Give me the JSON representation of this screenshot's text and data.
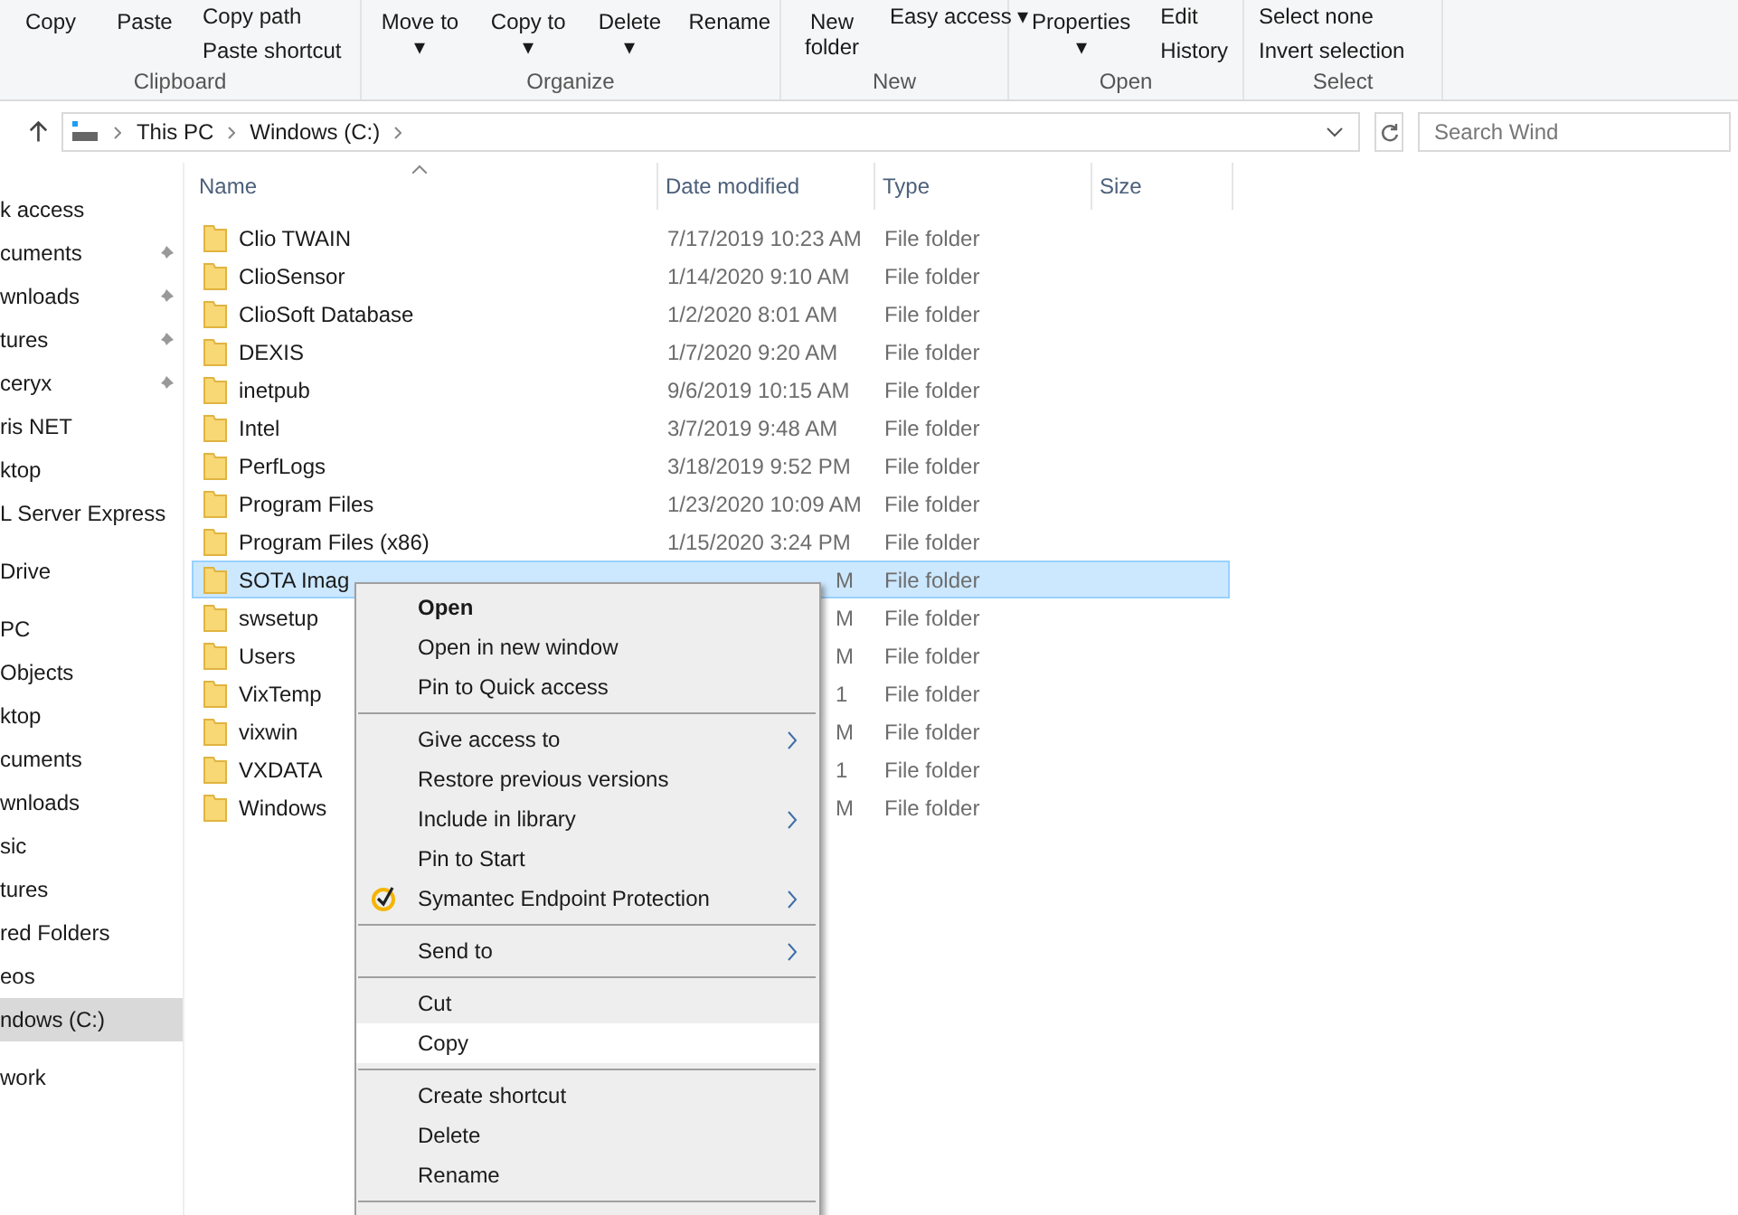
{
  "ribbon": {
    "groups": [
      {
        "label": "Clipboard",
        "large": [
          "Copy",
          "Paste"
        ],
        "small": [
          "Copy path",
          "Paste shortcut"
        ]
      },
      {
        "label": "Organize",
        "large": [
          "Move to ▾",
          "Copy to ▾",
          "Delete ▾",
          "Rename"
        ]
      },
      {
        "label": "New",
        "large": [
          "New folder"
        ],
        "small": [
          "Easy access ▾"
        ]
      },
      {
        "label": "Open",
        "large": [
          "Properties ▾"
        ],
        "small": [
          "Edit",
          "History"
        ]
      },
      {
        "label": "Select",
        "small": [
          "Select none",
          "Invert selection"
        ]
      }
    ]
  },
  "address_bar": {
    "crumbs": [
      "This PC",
      "Windows (C:)"
    ],
    "search_placeholder": "Search Wind"
  },
  "sidebar": {
    "sections": [
      {
        "items": [
          {
            "label": "k access",
            "pinned": false,
            "selected": false
          },
          {
            "label": "cuments",
            "pinned": true,
            "selected": false
          },
          {
            "label": "wnloads",
            "pinned": true,
            "selected": false
          },
          {
            "label": "tures",
            "pinned": true,
            "selected": false
          },
          {
            "label": "ceryx",
            "pinned": true,
            "selected": false
          },
          {
            "label": "ris NET",
            "pinned": false,
            "selected": false
          },
          {
            "label": "ktop",
            "pinned": false,
            "selected": false
          },
          {
            "label": "L Server Express",
            "pinned": false,
            "selected": false
          }
        ]
      },
      {
        "items": [
          {
            "label": "Drive",
            "pinned": false,
            "selected": false
          }
        ]
      },
      {
        "items": [
          {
            "label": "PC",
            "pinned": false,
            "selected": false
          },
          {
            "label": "Objects",
            "pinned": false,
            "selected": false
          },
          {
            "label": "ktop",
            "pinned": false,
            "selected": false
          },
          {
            "label": "cuments",
            "pinned": false,
            "selected": false
          },
          {
            "label": "wnloads",
            "pinned": false,
            "selected": false
          },
          {
            "label": "sic",
            "pinned": false,
            "selected": false
          },
          {
            "label": "tures",
            "pinned": false,
            "selected": false
          },
          {
            "label": "red Folders",
            "pinned": false,
            "selected": false
          },
          {
            "label": "eos",
            "pinned": false,
            "selected": false
          },
          {
            "label": "ndows (C:)",
            "pinned": false,
            "selected": true
          }
        ]
      },
      {
        "items": [
          {
            "label": "work",
            "pinned": false,
            "selected": false
          }
        ]
      }
    ]
  },
  "table": {
    "columns": [
      "Name",
      "Date modified",
      "Type",
      "Size"
    ],
    "rows": [
      {
        "name": "Clio TWAIN",
        "date": "7/17/2019 10:23 AM",
        "date_covered": false,
        "type": "File folder",
        "selected": false
      },
      {
        "name": "ClioSensor",
        "date": "1/14/2020 9:10 AM",
        "date_covered": false,
        "type": "File folder",
        "selected": false
      },
      {
        "name": "ClioSoft Database",
        "date": "1/2/2020 8:01 AM",
        "date_covered": false,
        "type": "File folder",
        "selected": false
      },
      {
        "name": "DEXIS",
        "date": "1/7/2020 9:20 AM",
        "date_covered": false,
        "type": "File folder",
        "selected": false
      },
      {
        "name": "inetpub",
        "date": "9/6/2019 10:15 AM",
        "date_covered": false,
        "type": "File folder",
        "selected": false
      },
      {
        "name": "Intel",
        "date": "3/7/2019 9:48 AM",
        "date_covered": false,
        "type": "File folder",
        "selected": false
      },
      {
        "name": "PerfLogs",
        "date": "3/18/2019 9:52 PM",
        "date_covered": false,
        "type": "File folder",
        "selected": false
      },
      {
        "name": "Program Files",
        "date": "1/23/2020 10:09 AM",
        "date_covered": false,
        "type": "File folder",
        "selected": false
      },
      {
        "name": "Program Files (x86)",
        "date": "1/15/2020 3:24 PM",
        "date_covered": false,
        "type": "File folder",
        "selected": false
      },
      {
        "name": "SOTA Imag",
        "date": "M",
        "date_covered": true,
        "type": "File folder",
        "selected": true
      },
      {
        "name": "swsetup",
        "date": "M",
        "date_covered": true,
        "type": "File folder",
        "selected": false
      },
      {
        "name": "Users",
        "date": "M",
        "date_covered": true,
        "type": "File folder",
        "selected": false
      },
      {
        "name": "VixTemp",
        "date": "1",
        "date_covered": true,
        "type": "File folder",
        "selected": false
      },
      {
        "name": "vixwin",
        "date": "M",
        "date_covered": true,
        "type": "File folder",
        "selected": false
      },
      {
        "name": "VXDATA",
        "date": "1",
        "date_covered": true,
        "type": "File folder",
        "selected": false
      },
      {
        "name": "Windows",
        "date": "M",
        "date_covered": true,
        "type": "File folder",
        "selected": false
      }
    ]
  },
  "context_menu": {
    "items": [
      {
        "kind": "item",
        "label": "Open",
        "bold": true,
        "submenu": false,
        "hovered": false
      },
      {
        "kind": "item",
        "label": "Open in new window",
        "bold": false,
        "submenu": false,
        "hovered": false
      },
      {
        "kind": "item",
        "label": "Pin to Quick access",
        "bold": false,
        "submenu": false,
        "hovered": false
      },
      {
        "kind": "separator"
      },
      {
        "kind": "item",
        "label": "Give access to",
        "bold": false,
        "submenu": true,
        "hovered": false
      },
      {
        "kind": "item",
        "label": "Restore previous versions",
        "bold": false,
        "submenu": false,
        "hovered": false
      },
      {
        "kind": "item",
        "label": "Include in library",
        "bold": false,
        "submenu": true,
        "hovered": false
      },
      {
        "kind": "item",
        "label": "Pin to Start",
        "bold": false,
        "submenu": false,
        "hovered": false
      },
      {
        "kind": "icon_item",
        "label": "Symantec Endpoint Protection",
        "bold": false,
        "submenu": true,
        "hovered": false
      },
      {
        "kind": "separator"
      },
      {
        "kind": "item",
        "label": "Send to",
        "bold": false,
        "submenu": true,
        "hovered": false
      },
      {
        "kind": "separator"
      },
      {
        "kind": "item",
        "label": "Cut",
        "bold": false,
        "submenu": false,
        "hovered": false
      },
      {
        "kind": "item",
        "label": "Copy",
        "bold": false,
        "submenu": false,
        "hovered": true
      },
      {
        "kind": "separator"
      },
      {
        "kind": "item",
        "label": "Create shortcut",
        "bold": false,
        "submenu": false,
        "hovered": false
      },
      {
        "kind": "item",
        "label": "Delete",
        "bold": false,
        "submenu": false,
        "hovered": false
      },
      {
        "kind": "item",
        "label": "Rename",
        "bold": false,
        "submenu": false,
        "hovered": false
      },
      {
        "kind": "separator"
      }
    ]
  }
}
